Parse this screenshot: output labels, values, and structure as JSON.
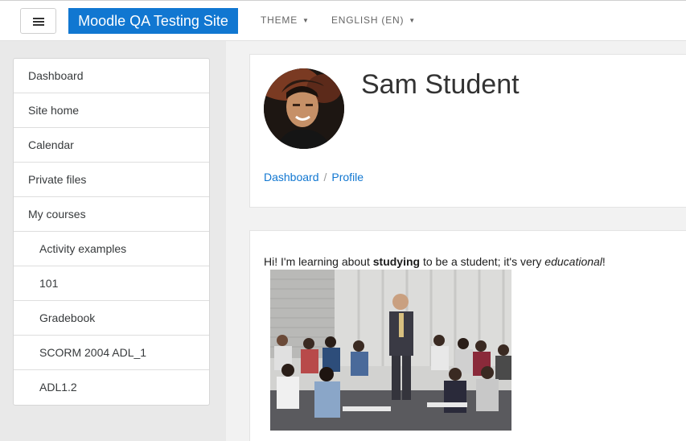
{
  "navbar": {
    "brand": "Moodle QA Testing Site",
    "theme_menu": "THEME",
    "language_menu": "ENGLISH (EN)"
  },
  "sidebar": {
    "items": [
      {
        "label": "Dashboard"
      },
      {
        "label": "Site home"
      },
      {
        "label": "Calendar"
      },
      {
        "label": "Private files"
      },
      {
        "label": "My courses"
      },
      {
        "label": "Activity examples"
      },
      {
        "label": "101"
      },
      {
        "label": "Gradebook"
      },
      {
        "label": "SCORM 2004 ADL_1"
      },
      {
        "label": "ADL1.2"
      }
    ]
  },
  "profile": {
    "name": "Sam Student",
    "breadcrumb": [
      "Dashboard",
      "Profile"
    ],
    "description": {
      "part1": "Hi! I'm learning about ",
      "bold": "studying",
      "part2": " to be a student; it's very ",
      "italic": "educational",
      "part3": "!"
    }
  },
  "colors": {
    "brand": "#1177d1",
    "link": "#1177d1"
  }
}
